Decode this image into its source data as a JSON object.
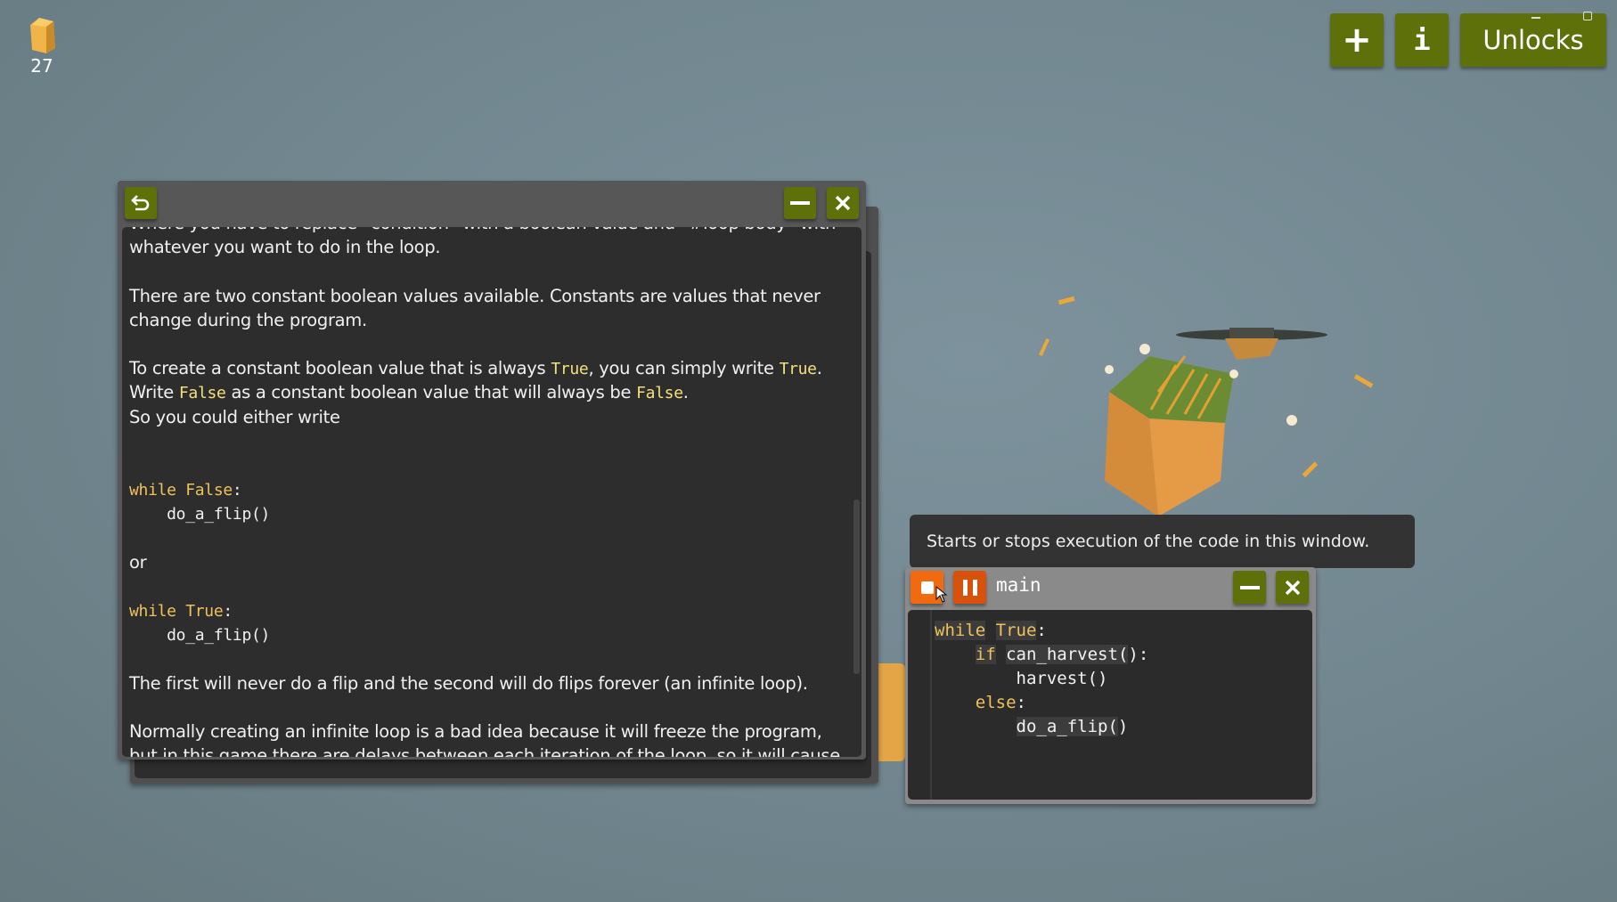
{
  "hud": {
    "hay_icon": "hay-bale-icon",
    "hay_count": "27"
  },
  "top_buttons": {
    "add_icon": "plus-icon",
    "add_label": "+",
    "info_label": "i",
    "unlocks_label": "Unlocks"
  },
  "colors": {
    "button_green": "#5e7009",
    "run_orange": "#f26a0f",
    "pause_orange": "#d9520c",
    "keyword_yellow": "#f0c15a",
    "inline_code": "#f4e07a"
  },
  "doc_window": {
    "back_icon": "undo-arrow-icon",
    "lines": [
      [
        {
          "t": "Where you have to replace `condition` with a boolean value and `#loop body` with"
        }
      ],
      [
        {
          "t": "whatever you want to do in the loop."
        }
      ],
      [],
      [
        {
          "t": "There are two constant boolean values available. Constants are values that never"
        }
      ],
      [
        {
          "t": "change during the program."
        }
      ],
      [],
      [
        {
          "t": "To create a constant boolean value that is always "
        },
        {
          "t": "True",
          "c": 1
        },
        {
          "t": ", you can simply write "
        },
        {
          "t": "True",
          "c": 1
        },
        {
          "t": "."
        }
      ],
      [
        {
          "t": "Write "
        },
        {
          "t": "False",
          "c": 1
        },
        {
          "t": " as a constant boolean value that will always be "
        },
        {
          "t": "False",
          "c": 1
        },
        {
          "t": "."
        }
      ],
      [
        {
          "t": "So you could either write"
        }
      ],
      [],
      [],
      [
        {
          "t": "while ",
          "c": 2,
          "k": 1
        },
        {
          "t": "False",
          "c": 2,
          "k": 1
        },
        {
          "t": ":",
          "c": 2
        }
      ],
      [
        {
          "t": "    do_a_flip()",
          "c": 2
        }
      ],
      [],
      [
        {
          "t": "or"
        }
      ],
      [],
      [
        {
          "t": "while ",
          "c": 2,
          "k": 1
        },
        {
          "t": "True",
          "c": 2,
          "k": 1
        },
        {
          "t": ":",
          "c": 2
        }
      ],
      [
        {
          "t": "    do_a_flip()",
          "c": 2
        }
      ],
      [],
      [
        {
          "t": "The first will never do a flip and the second will do flips forever (an infinite loop)."
        }
      ],
      [],
      [
        {
          "t": "Normally creating an infinite loop is a bad idea because it will freeze the program,"
        }
      ],
      [
        {
          "t": "but in this game there are delays between each iteration of the loop, so it will cause"
        }
      ]
    ]
  },
  "tooltip": {
    "text": "Starts or stops execution of the code in this window."
  },
  "code_window": {
    "title": "main",
    "code": [
      [
        {
          "t": "while",
          "k": 1,
          "h": 1
        },
        {
          "t": " "
        },
        {
          "t": "True",
          "k": 1,
          "h": 1
        },
        {
          "t": ":"
        }
      ],
      [
        {
          "t": "    "
        },
        {
          "t": "if",
          "k": 1,
          "h": 1
        },
        {
          "t": " "
        },
        {
          "t": "can_harvest(",
          "h": 1
        },
        {
          "t": "):"
        }
      ],
      [
        {
          "t": "        harvest()"
        }
      ],
      [
        {
          "t": "    "
        },
        {
          "t": "else",
          "k": 1
        },
        {
          "t": ":"
        }
      ],
      [
        {
          "t": "        "
        },
        {
          "t": "do_a_flip(",
          "h": 1
        },
        {
          "t": ")"
        }
      ]
    ]
  }
}
